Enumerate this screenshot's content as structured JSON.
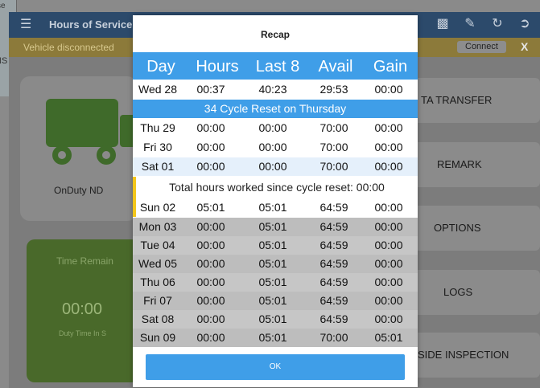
{
  "background": {
    "fragment_top": "se",
    "fragment_mid": "NS",
    "appbar": {
      "title": "Hours of Service",
      "menu_icon": "menu-icon",
      "icons": [
        "message-icon",
        "edit-icon",
        "refresh-icon",
        "logout-icon"
      ]
    },
    "banner": {
      "message": "Vehicle disconnected",
      "connect_label": "Connect",
      "close_label": "X"
    },
    "status_card": {
      "label": "OnDuty ND"
    },
    "time_card": {
      "title": "Time Remain",
      "value": "00:00",
      "subtitle": "Duty Time In S"
    },
    "side_buttons": [
      "TA TRANSFER",
      "REMARK",
      "OPTIONS",
      "LOGS",
      "SIDE INSPECTION"
    ]
  },
  "dialog": {
    "title": "Recap",
    "columns": [
      "Day",
      "Hours",
      "Last 8",
      "Avail",
      "Gain"
    ],
    "first_row": [
      "Wed 28",
      "00:37",
      "40:23",
      "29:53",
      "00:00"
    ],
    "cycle_reset_text": "34 Cycle Reset on Thursday",
    "rows_after_reset": [
      [
        "Thu 29",
        "00:00",
        "00:00",
        "70:00",
        "00:00"
      ],
      [
        "Fri 30",
        "00:00",
        "00:00",
        "70:00",
        "00:00"
      ],
      [
        "Sat 01",
        "00:00",
        "00:00",
        "70:00",
        "00:00"
      ]
    ],
    "total_hours_text": "Total hours worked since cycle reset: 00:00",
    "current_row": [
      "Sun 02",
      "05:01",
      "05:01",
      "64:59",
      "00:00"
    ],
    "future_rows": [
      [
        "Mon 03",
        "00:00",
        "05:01",
        "64:59",
        "00:00"
      ],
      [
        "Tue 04",
        "00:00",
        "05:01",
        "64:59",
        "00:00"
      ],
      [
        "Wed 05",
        "00:00",
        "05:01",
        "64:59",
        "00:00"
      ],
      [
        "Thu 06",
        "00:00",
        "05:01",
        "64:59",
        "00:00"
      ],
      [
        "Fri 07",
        "00:00",
        "05:01",
        "64:59",
        "00:00"
      ],
      [
        "Sat 08",
        "00:00",
        "05:01",
        "64:59",
        "00:00"
      ],
      [
        "Sun 09",
        "00:00",
        "05:01",
        "70:00",
        "05:01"
      ]
    ],
    "ok_label": "OK",
    "colors": {
      "accent": "#3f9ee8",
      "highlight_bar": "#f3c61a",
      "future_row_bg": "#bdbdbd"
    }
  }
}
